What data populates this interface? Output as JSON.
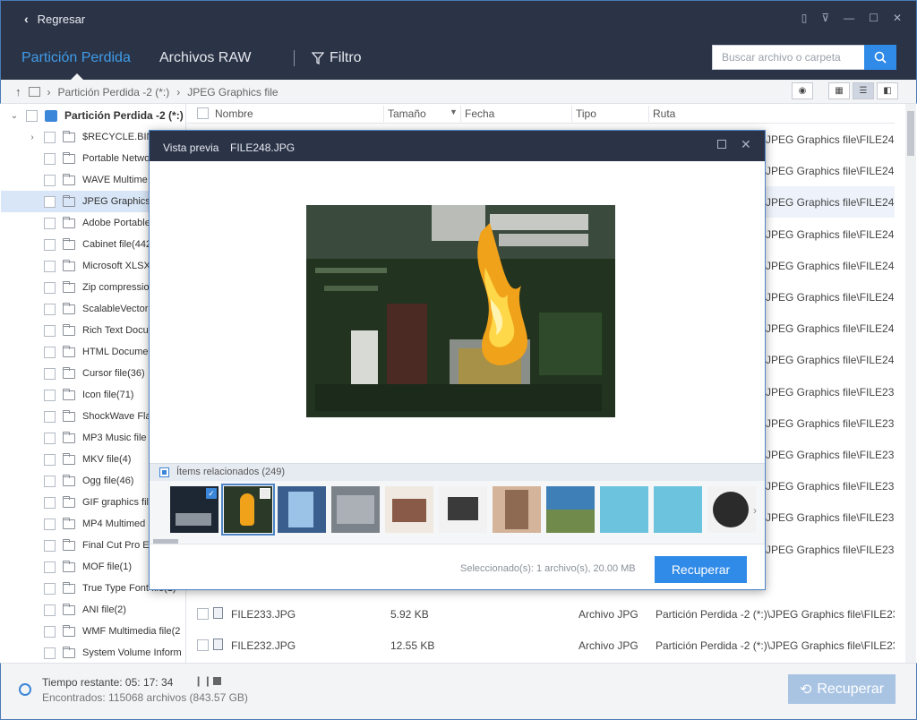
{
  "window": {
    "back_label": "Regresar"
  },
  "nav": {
    "tabs": [
      "Partición Perdida",
      "Archivos RAW"
    ],
    "filter_label": "Filtro",
    "search_placeholder": "Buscar archivo o carpeta"
  },
  "breadcrumb": {
    "items": [
      "Partición Perdida -2 (*:)",
      "JPEG Graphics file"
    ]
  },
  "sidebar": {
    "root_label": "Partición Perdida -2 (*:)",
    "items": [
      "$RECYCLE.BIN(",
      "Portable Netwo",
      "WAVE Multime",
      "JPEG Graphics f",
      "Adobe Portable",
      "Cabinet file(442",
      "Microsoft XLSX",
      "Zip compressio",
      "ScalableVector(",
      "Rich Text Docu",
      "HTML Docume",
      "Cursor file(36)",
      "Icon file(71)",
      "ShockWave Fla",
      "MP3 Music file",
      "MKV file(4)",
      "Ogg file(46)",
      "GIF graphics fil",
      "MP4 Multimed",
      "Final Cut Pro E",
      "MOF file(1)",
      "True Type Font file(1)",
      "ANI file(2)",
      "WMF Multimedia file(2",
      "System Volume Inform"
    ]
  },
  "table": {
    "headers": {
      "name": "Nombre",
      "size": "Tamaño",
      "date": "Fecha",
      "type": "Tipo",
      "path": "Ruta"
    },
    "path_fragments": [
      "JPEG Graphics file\\FILE24...",
      "JPEG Graphics file\\FILE24...",
      "JPEG Graphics file\\FILE24...",
      "JPEG Graphics file\\FILE24...",
      "JPEG Graphics file\\FILE24...",
      "JPEG Graphics file\\FILE24...",
      "JPEG Graphics file\\FILE24...",
      "JPEG Graphics file\\FILE24...",
      "JPEG Graphics file\\FILE23...",
      "JPEG Graphics file\\FILE23...",
      "JPEG Graphics file\\FILE23...",
      "JPEG Graphics file\\FILE23...",
      "JPEG Graphics file\\FILE23...",
      "JPEG Graphics file\\FILE23..."
    ],
    "full_rows": [
      {
        "name": "FILE233.JPG",
        "size": "5.92 KB",
        "type": "Archivo JPG",
        "path": "Partición Perdida -2 (*:)\\JPEG Graphics file\\FILE23..."
      },
      {
        "name": "FILE232.JPG",
        "size": "12.55 KB",
        "type": "Archivo JPG",
        "path": "Partición Perdida -2 (*:)\\JPEG Graphics file\\FILE23..."
      }
    ]
  },
  "preview": {
    "title": "Vista previa",
    "filename": "FILE248.JPG",
    "related_label": "Ítems relacionados (249)",
    "selection_info": "Seleccionado(s): 1 archivo(s), 20.00 MB",
    "recover_label": "Recuperar"
  },
  "status": {
    "remaining": "Tiempo restante: 05: 17: 34",
    "found": "Encontrados: 115068 archivos (843.57 GB)",
    "recover_label": "Recuperar"
  },
  "colors": {
    "titlebar": "#2b3447",
    "accent": "#2f8ae8",
    "active_tab": "#3f9be8",
    "disabled_button": "#a9c4e3"
  }
}
